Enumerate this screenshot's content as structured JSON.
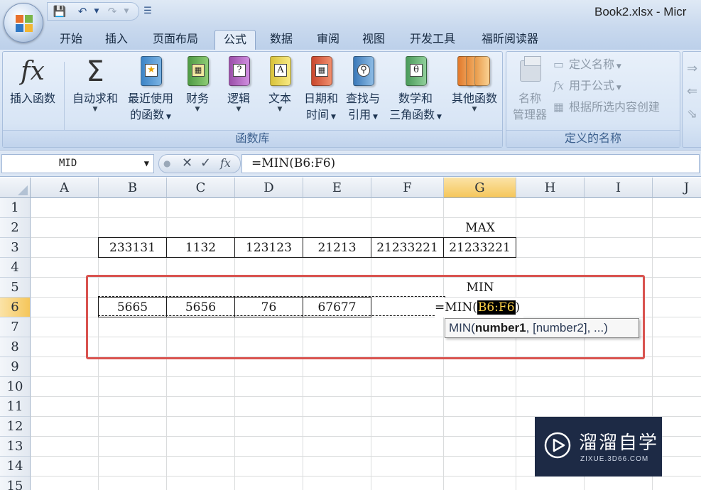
{
  "window": {
    "title": "Book2.xlsx - Micr"
  },
  "tabs": [
    {
      "label": "开始"
    },
    {
      "label": "插入"
    },
    {
      "label": "页面布局"
    },
    {
      "label": "公式"
    },
    {
      "label": "数据"
    },
    {
      "label": "审阅"
    },
    {
      "label": "视图"
    },
    {
      "label": "开发工具"
    },
    {
      "label": "福昕阅读器"
    }
  ],
  "ribbon": {
    "function_library": {
      "label": "函数库",
      "insert_function": "插入函数",
      "autosum": "自动求和",
      "recent_1": "最近使用",
      "recent_2": "的函数",
      "financial": "财务",
      "logical": "逻辑",
      "text": "文本",
      "datetime_1": "日期和",
      "datetime_2": "时间",
      "lookup_1": "查找与",
      "lookup_2": "引用",
      "math_1": "数学和",
      "math_2": "三角函数",
      "more": "其他函数"
    },
    "defined_names": {
      "label": "定义的名称",
      "name_manager_1": "名称",
      "name_manager_2": "管理器",
      "define_name": "定义名称",
      "use_in_formula": "用于公式",
      "create_from_selection": "根据所选内容创建"
    }
  },
  "formula_bar": {
    "name_box": "MID",
    "formula": "=MIN(B6:F6)"
  },
  "grid": {
    "columns": [
      "A",
      "B",
      "C",
      "D",
      "E",
      "F",
      "G",
      "H",
      "I",
      "J"
    ],
    "rows": [
      "1",
      "2",
      "3",
      "4",
      "5",
      "6",
      "7",
      "8",
      "9",
      "10",
      "11",
      "12",
      "13",
      "14",
      "15"
    ],
    "cells": {
      "G2": "MAX",
      "B3": "233131",
      "C3": "1132",
      "D3": "123123",
      "E3": "21213",
      "F3": "21233221",
      "G3": "21233221",
      "G5": "MIN",
      "B6": "5665",
      "C6": "5656",
      "D6": "76",
      "E6": "67677",
      "G6_prefix": "=MIN(",
      "G6_ref": "B6:F6",
      "G6_suffix": ")"
    },
    "tooltip": {
      "fn": "MIN(",
      "arg1": "number1",
      "rest": ", [number2], ...)"
    }
  },
  "watermark": {
    "text": "溜溜自学",
    "sub": "ZIXUE.3D66.COM"
  }
}
